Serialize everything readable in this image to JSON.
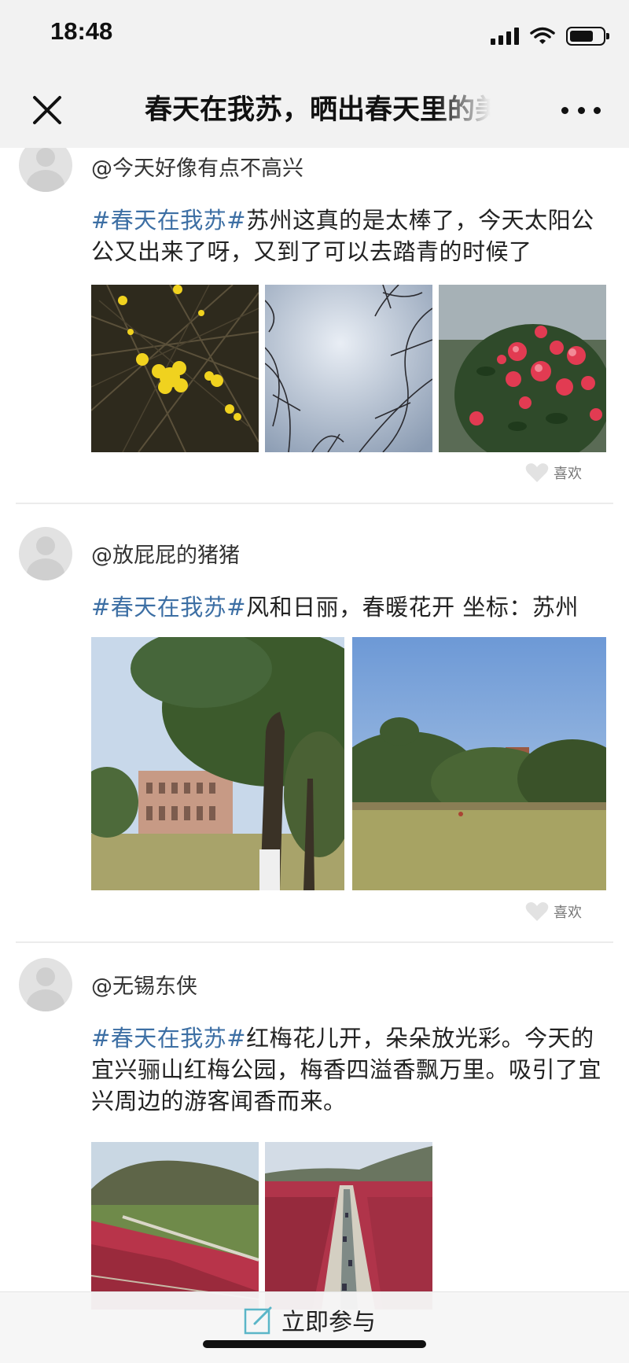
{
  "status_bar": {
    "time": "18:48"
  },
  "header": {
    "title": "春天在我苏，晒出春天里的美",
    "close_icon": "close-icon",
    "more_icon": "more-dots-icon"
  },
  "posts": [
    {
      "username": "@今天好像有点不高兴",
      "tag": "#春天在我苏#",
      "text": "苏州这真的是太棒了，今天太阳公公又出来了呀，又到了可以去踏青的时候了",
      "photos": [
        "yellow-jasmine-flowers",
        "bare-branches-sky",
        "red-camellia-flowers"
      ],
      "like_label": "喜欢"
    },
    {
      "username": "@放屁屁的猪猪",
      "tag": "#春天在我苏#",
      "text": "风和日丽，春暖花开 坐标：苏州",
      "photos": [
        "campus-lawn-tree-building",
        "campus-lawn-trees"
      ],
      "like_label": "喜欢"
    },
    {
      "username": "@无锡东侠",
      "tag": "#春天在我苏#",
      "text": "红梅花儿开，朵朵放光彩。今天的宜兴骊山红梅公园，梅香四溢香飘万里。吸引了宜兴周边的游客闻香而来。",
      "photos": [
        "plum-garden-hills",
        "plum-garden-aerial-road"
      ]
    }
  ],
  "bottom_bar": {
    "join_label": "立即参与",
    "join_icon": "edit-icon"
  },
  "colors": {
    "tag": "#3d6fa4",
    "header_bg": "#f2f2f2",
    "like_gray": "#777777"
  }
}
